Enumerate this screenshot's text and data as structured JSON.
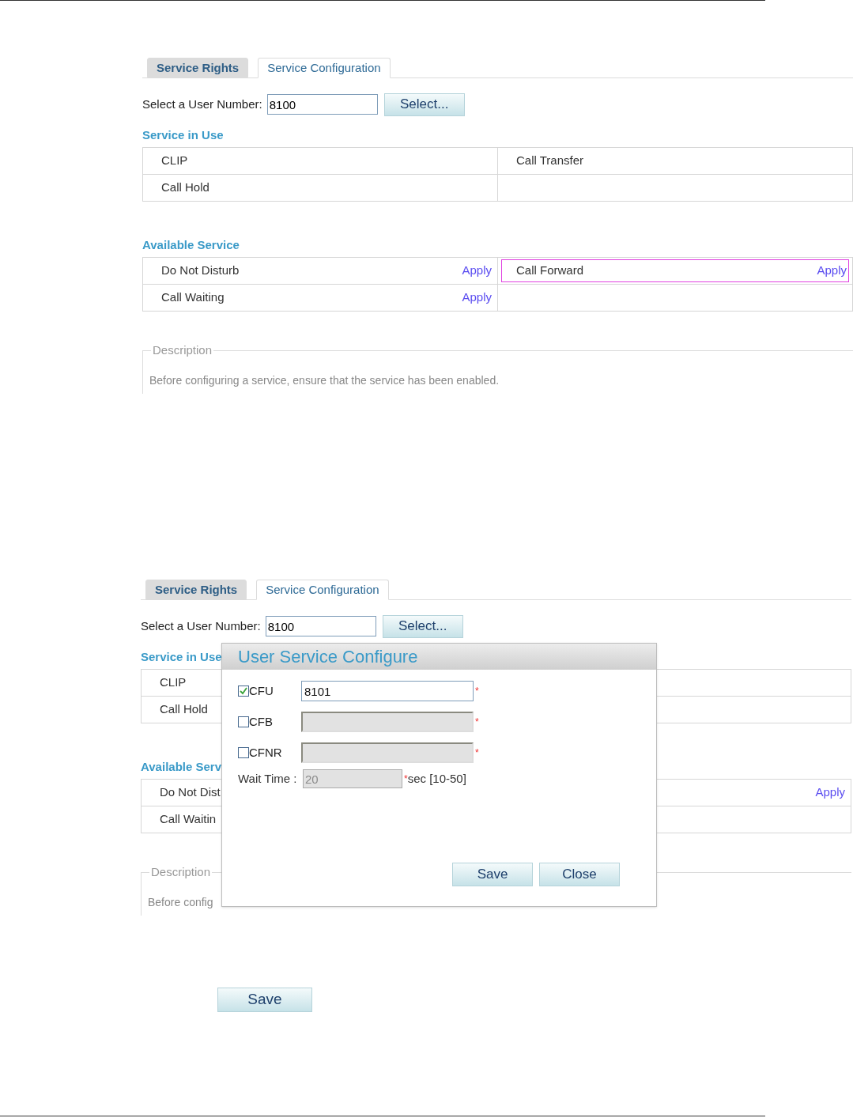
{
  "screens": [
    {
      "tabs": [
        {
          "label": "Service Rights",
          "selected": false
        },
        {
          "label": "Service Configuration",
          "selected": true
        }
      ],
      "user_number": {
        "label": "Select a User Number:",
        "value": "8100",
        "button": "Select..."
      },
      "service_in_use": {
        "title": "Service in Use",
        "rows": [
          [
            {
              "name": "CLIP"
            },
            {
              "name": "Call Transfer"
            }
          ],
          [
            {
              "name": "Call Hold"
            },
            {}
          ]
        ]
      },
      "available_service": {
        "title": "Available Service",
        "rows": [
          [
            {
              "name": "Do Not Disturb",
              "action": "Apply",
              "highlighted": false
            },
            {
              "name": "Call Forward",
              "action": "Apply",
              "highlighted": true
            }
          ],
          [
            {
              "name": "Call Waiting",
              "action": "Apply",
              "highlighted": false
            },
            {}
          ]
        ]
      },
      "description": {
        "legend": "Description",
        "text": "Before configuring a service, ensure that the service has been enabled."
      }
    },
    {
      "tabs": [
        {
          "label": "Service Rights",
          "selected": false
        },
        {
          "label": "Service Configuration",
          "selected": true
        }
      ],
      "user_number": {
        "label": "Select a User Number:",
        "value": "8100",
        "button": "Select..."
      },
      "service_in_use": {
        "title": "Service in Use",
        "rows": [
          [
            {
              "name": "CLIP"
            },
            {}
          ],
          [
            {
              "name": "Call Hold"
            },
            {}
          ]
        ]
      },
      "available_service": {
        "title": "Available Serv",
        "rows": [
          [
            {
              "name": "Do Not Dist",
              "highlighted": false
            },
            {
              "action": "Apply",
              "highlighted": false
            }
          ],
          [
            {
              "name": "Call Waitin",
              "highlighted": false
            },
            {}
          ]
        ]
      },
      "description": {
        "legend": "Description",
        "text": "Before config"
      },
      "dialog": {
        "title": "User Service Configure",
        "options": [
          {
            "label": "CFU",
            "checked": true,
            "value": "8101",
            "disabled": false,
            "required_mark": "*"
          },
          {
            "label": "CFB",
            "checked": false,
            "disabled": true,
            "required_mark": "*"
          },
          {
            "label": "CFNR",
            "checked": false,
            "disabled": true,
            "required_mark": "*"
          }
        ],
        "wait_time": {
          "label": "Wait Time :",
          "value": "20",
          "disabled": true,
          "required_mark": "*",
          "unit": "sec [10-50]"
        },
        "buttons": [
          "Save",
          "Close"
        ]
      }
    }
  ],
  "save_button": "Save"
}
